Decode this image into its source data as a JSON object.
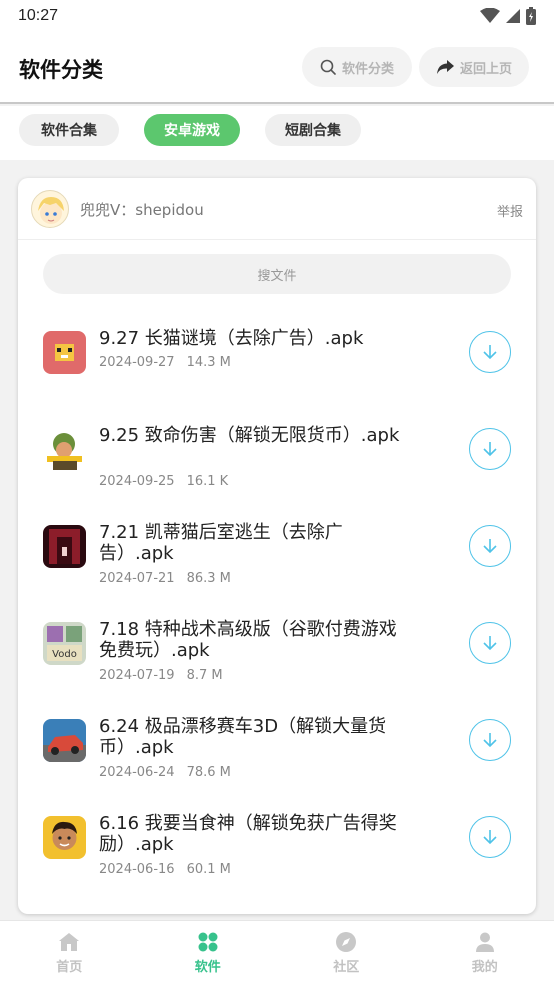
{
  "status_bar": {
    "time": "10:27"
  },
  "header": {
    "title": "软件分类",
    "search_label": "软件分类",
    "back_label": "返回上页"
  },
  "tabs": [
    {
      "label": "软件合集",
      "active": false
    },
    {
      "label": "安卓游戏",
      "active": true
    },
    {
      "label": "短剧合集",
      "active": false
    }
  ],
  "owner": {
    "name": "兜兜V：shepidou",
    "report_label": "举报"
  },
  "search": {
    "placeholder": "搜文件"
  },
  "files": [
    {
      "name": "9.27 长猫谜境（去除广告）.apk",
      "date": "2024-09-27",
      "size": "14.3 M",
      "icon": "cat-game-icon",
      "color": "#e06a6a"
    },
    {
      "name": "9.25 致命伤害（解锁无限货币）.apk",
      "date": "2024-09-25",
      "size": "16.1 K",
      "icon": "soldier-game-icon",
      "color": "#6b8f3a"
    },
    {
      "name": "7.21 凯蒂猫后室逃生（去除广告）.apk",
      "date": "2024-07-21",
      "size": "86.3 M",
      "icon": "backroom-game-icon",
      "color": "#8c1d2a"
    },
    {
      "name": "7.18 特种战术高级版（谷歌付费游戏免费玩）.apk",
      "date": "2024-07-19",
      "size": "8.7 M",
      "icon": "vodo-game-icon",
      "color": "#7aa27a"
    },
    {
      "name": "6.24 极品漂移赛车3D（解锁大量货币）.apk",
      "date": "2024-06-24",
      "size": "78.6 M",
      "icon": "racing-game-icon",
      "color": "#d84a3a"
    },
    {
      "name": "6.16 我要当食神（解锁免获广告得奖励）.apk",
      "date": "2024-06-16",
      "size": "60.1 M",
      "icon": "chef-game-icon",
      "color": "#f2c02e"
    }
  ],
  "bottom_nav": [
    {
      "label": "首页",
      "icon": "home-icon",
      "active": false
    },
    {
      "label": "软件",
      "icon": "grid-icon",
      "active": true
    },
    {
      "label": "社区",
      "icon": "compass-icon",
      "active": false
    },
    {
      "label": "我的",
      "icon": "user-icon",
      "active": false
    }
  ],
  "colors": {
    "accent": "#5cc76e",
    "download": "#4fc3e8",
    "nav_active": "#37c28c"
  }
}
